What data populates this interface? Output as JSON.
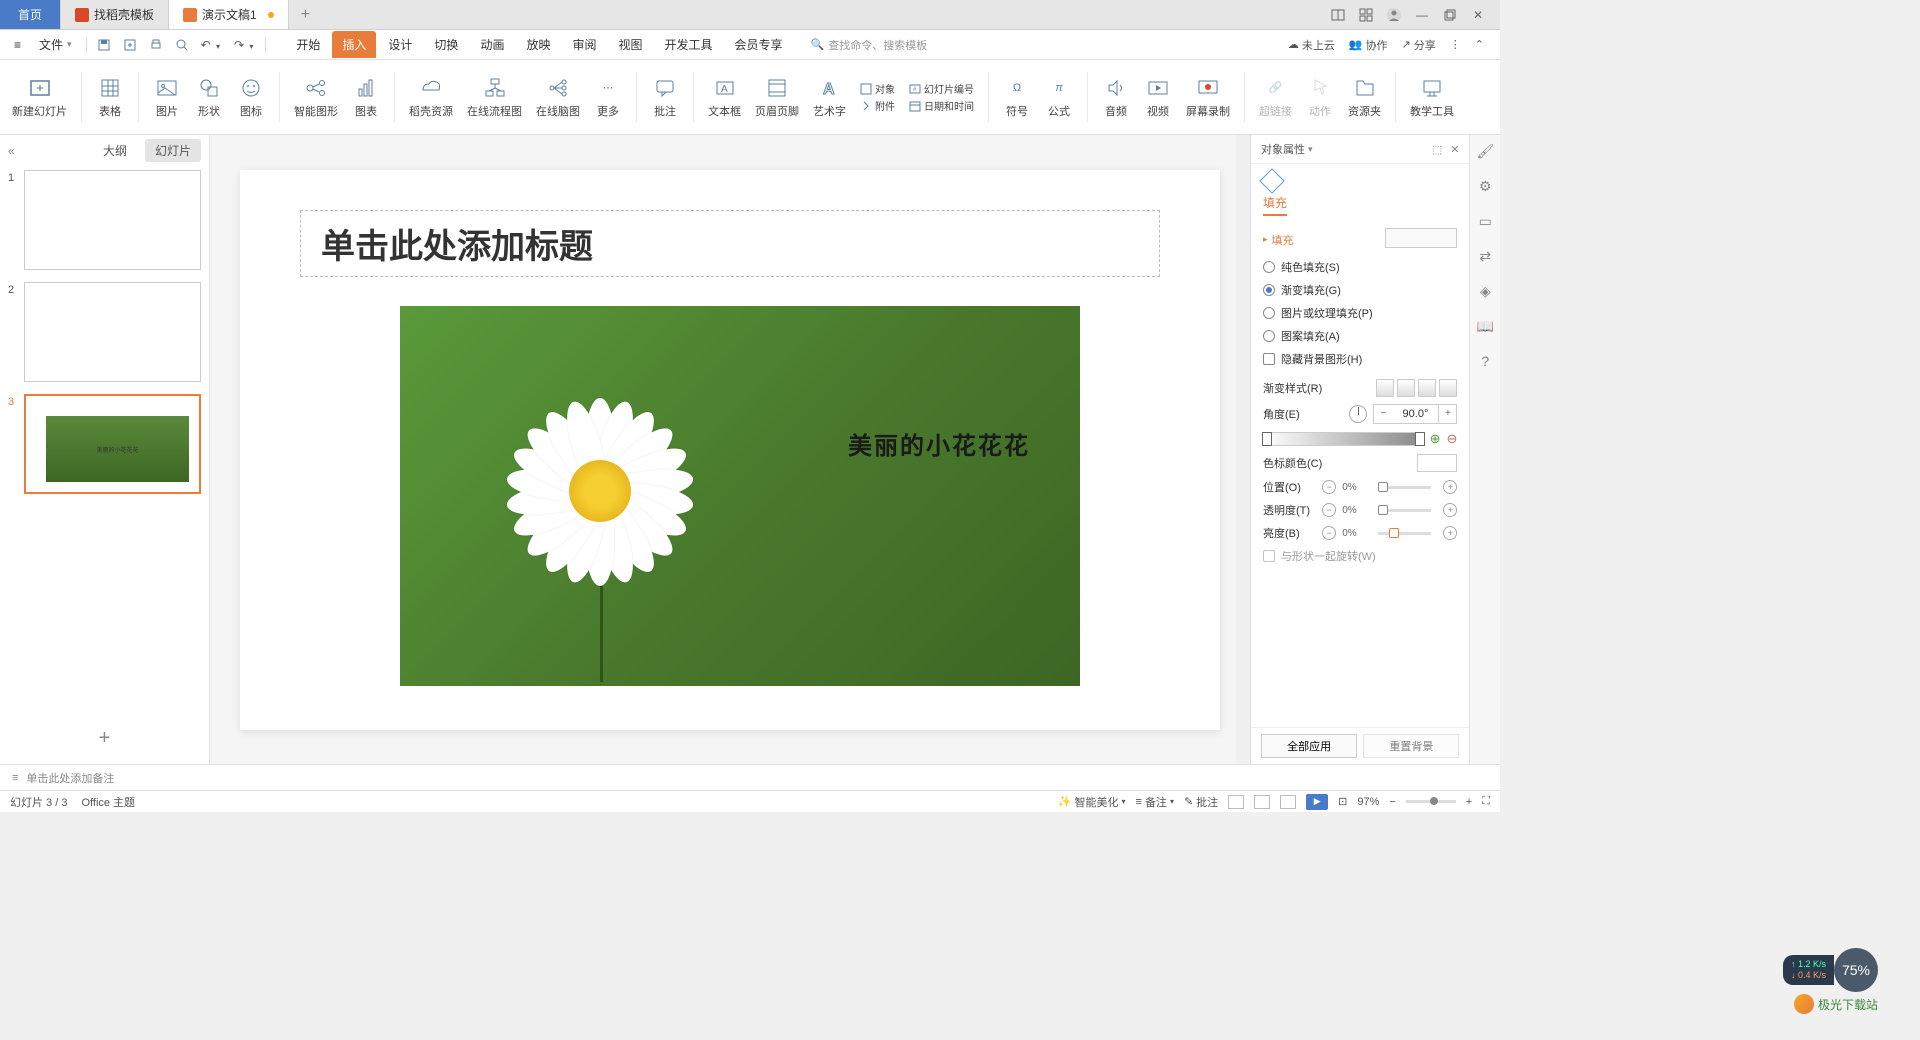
{
  "titlebar": {
    "tabs": [
      {
        "label": "首页"
      },
      {
        "label": "找稻壳模板"
      },
      {
        "label": "演示文稿1"
      }
    ]
  },
  "menu": {
    "file_label": "文件",
    "tabs": [
      "开始",
      "插入",
      "设计",
      "切换",
      "动画",
      "放映",
      "审阅",
      "视图",
      "开发工具",
      "会员专享"
    ],
    "active_tab": 1,
    "search_placeholder": "查找命令、搜索模板",
    "right": {
      "cloud": "未上云",
      "collab": "协作",
      "share": "分享"
    }
  },
  "ribbon": [
    "新建幻灯片",
    "表格",
    "图片",
    "形状",
    "图标",
    "智能图形",
    "图表",
    "稻壳资源",
    "在线流程图",
    "在线脑图",
    "更多",
    "批注",
    "文本框",
    "页眉页脚",
    "艺术字",
    "对象",
    "幻灯片编号",
    "符号",
    "公式",
    "音频",
    "视频",
    "屏幕录制",
    "超链接",
    "动作",
    "资源夹",
    "教学工具"
  ],
  "ribbon_extras": {
    "attach": "附件",
    "datetime": "日期和时间"
  },
  "slidepanel": {
    "tab_outline": "大纲",
    "tab_slides": "幻灯片",
    "thumb_text": "美丽的小花花花"
  },
  "slide": {
    "title_placeholder": "单击此处添加标题",
    "image_caption": "美丽的小花花花"
  },
  "props": {
    "header": "对象属性",
    "fill_tab": "填充",
    "section_fill": "填充",
    "opt_solid": "纯色填充(S)",
    "opt_gradient": "渐变填充(G)",
    "opt_picture": "图片或纹理填充(P)",
    "opt_pattern": "图案填充(A)",
    "opt_hidebg": "隐藏背景图形(H)",
    "gradient_style": "渐变样式(R)",
    "angle": "角度(E)",
    "angle_val": "90.0°",
    "stop_color": "色标颜色(C)",
    "position": "位置(O)",
    "transparency": "透明度(T)",
    "brightness": "亮度(B)",
    "rotate_with_shape": "与形状一起旋转(W)",
    "pct0": "0%",
    "apply_all": "全部应用",
    "reset_bg": "重置背景"
  },
  "notes": {
    "placeholder": "单击此处添加备注"
  },
  "status": {
    "left": "幻灯片 3 / 3",
    "theme": "Office 主题",
    "beautify": "智能美化",
    "notes": "备注",
    "comments": "批注",
    "zoom": "97%"
  },
  "float": {
    "up": "1.2 K/s",
    "down": "0.4 K/s",
    "pct": "75%"
  },
  "watermark": "极光下载站"
}
